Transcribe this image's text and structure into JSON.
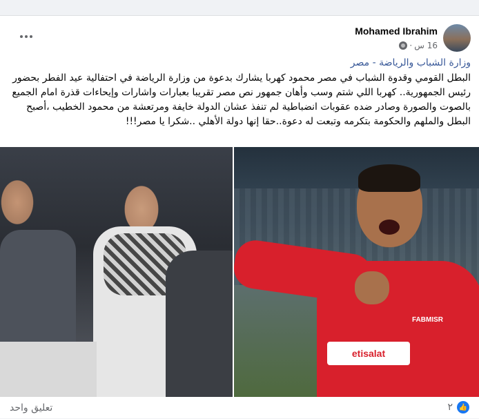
{
  "post": {
    "author": "Mohamed Ibrahim",
    "time": "16 س",
    "privacy_icon": "globe-icon",
    "tagged_page": "وزارة الشباب والرياضة - مصر",
    "text": "البطل القومي وقدوة الشباب في مصر محمود كهربا يشارك بدعوة من وزارة الرياضة في احتفالية عيد الفطر بحضور رئيس الجمهورية.. كهربا اللي شتم وسب وأهان جمهور نص مصر تقريبا بعبارات واشارات وإيحاءات قذرة امام الجميع بالصوت والصورة وصادر ضده عقوبات انضباطية لم تنفذ عشان الدولة خايفة ومرتعشة من محمود الخطيب ،أصبح البطل والملهم والحكومة بتكرمه وتبعت له دعوة..حقا إنها دولة الأهلي ..شكرا يا مصر!!!",
    "photo_right_sponsor": "etisalat",
    "photo_right_sponsor2": "FABMISR"
  },
  "footer": {
    "comments_label": "تعليق واحد",
    "reaction_count": "٢",
    "reaction_icon": "like-icon"
  },
  "colors": {
    "link": "#385898",
    "meta": "#65676b",
    "like": "#1877f2"
  }
}
